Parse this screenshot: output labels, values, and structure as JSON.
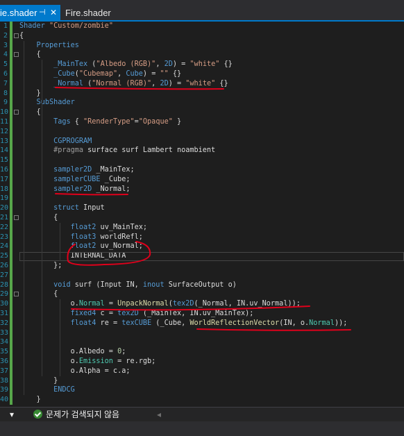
{
  "tabs": [
    {
      "label": "ie.shader",
      "active": true,
      "pin_glyph": "⊣",
      "close_glyph": "✕"
    },
    {
      "label": "Fire.shader",
      "active": false
    }
  ],
  "code_lines": [
    {
      "n": "1",
      "html": "<span class=\"kw\">Shader</span> <span class=\"str\">\"Custom/zombie\"</span>"
    },
    {
      "n": "2",
      "html": "{"
    },
    {
      "n": "3",
      "html": "    <span class=\"kw\">Properties</span>"
    },
    {
      "n": "4",
      "html": "    {"
    },
    {
      "n": "5",
      "html": "        <span class=\"kw\">_MainTex</span> (<span class=\"str\">\"Albedo (RGB)\"</span>, <span class=\"kw\">2D</span>) = <span class=\"str\">\"white\"</span> {}"
    },
    {
      "n": "6",
      "html": "        <span class=\"kw\">_Cube</span>(<span class=\"str\">\"Cubemap\"</span>, <span class=\"kw\">Cube</span>) = <span class=\"str\">\"\"</span> {}"
    },
    {
      "n": "7",
      "html": "        <span class=\"kw\">_Normal</span> (<span class=\"str\">\"Normal (RGB)\"</span>, <span class=\"kw\">2D</span>) = <span class=\"str\">\"white\"</span> {}"
    },
    {
      "n": "8",
      "html": "    }"
    },
    {
      "n": "9",
      "html": "    <span class=\"kw\">SubShader</span>"
    },
    {
      "n": "10",
      "html": "    {"
    },
    {
      "n": "11",
      "html": "        <span class=\"kw\">Tags</span> { <span class=\"str\">\"RenderType\"</span>=<span class=\"str\">\"Opaque\"</span> }"
    },
    {
      "n": "12",
      "html": ""
    },
    {
      "n": "13",
      "html": "        <span class=\"kw\">CGPROGRAM</span>"
    },
    {
      "n": "14",
      "html": "        <span class=\"pp\">#pragma</span> surface surf Lambert noambient"
    },
    {
      "n": "15",
      "html": ""
    },
    {
      "n": "16",
      "html": "        <span class=\"kw\">sampler2D</span> _MainTex;"
    },
    {
      "n": "17",
      "html": "        <span class=\"kw\">samplerCUBE</span> _Cube;"
    },
    {
      "n": "18",
      "html": "        <span class=\"kw\">sampler2D</span> _Normal;"
    },
    {
      "n": "19",
      "html": ""
    },
    {
      "n": "20",
      "html": "        <span class=\"kw\">struct</span> Input"
    },
    {
      "n": "21",
      "html": "        {"
    },
    {
      "n": "22",
      "html": "            <span class=\"kw\">float2</span> uv_MainTex;"
    },
    {
      "n": "23",
      "html": "            <span class=\"kw\">float3</span> worldRefl;"
    },
    {
      "n": "24",
      "html": "            <span class=\"kw\">float2</span> uv_Normal;"
    },
    {
      "n": "25",
      "html": "            INTERNAL_DATA"
    },
    {
      "n": "26",
      "html": "        };"
    },
    {
      "n": "27",
      "html": ""
    },
    {
      "n": "28",
      "html": "        <span class=\"kw\">void</span> surf (Input IN, <span class=\"kw\">inout</span> SurfaceOutput o)"
    },
    {
      "n": "29",
      "html": "        {"
    },
    {
      "n": "30",
      "html": "            o.<span class=\"fld\">Normal</span> = <span class=\"fn\">UnpackNormal</span>(<span class=\"kw\">tex2D</span>(_Normal, IN.uv_Normal));"
    },
    {
      "n": "31",
      "html": "            <span class=\"kw\">fixed4</span> c = <span class=\"kw\">tex2D</span> (_MainTex, IN.uv_MainTex);"
    },
    {
      "n": "32",
      "html": "            <span class=\"kw\">float4</span> re = <span class=\"kw\">texCUBE</span> (_Cube, <span class=\"fn\">WorldReflectionVector</span>(IN, o.<span class=\"fld\">Normal</span>));"
    },
    {
      "n": "33",
      "html": ""
    },
    {
      "n": "34",
      "html": ""
    },
    {
      "n": "35",
      "html": "            o.Albedo = <span class=\"num\">0</span>;"
    },
    {
      "n": "36",
      "html": "            o.<span class=\"fld\">Emission</span> = re.rgb;"
    },
    {
      "n": "37",
      "html": "            o.Alpha = c.a;"
    },
    {
      "n": "38",
      "html": "        }"
    },
    {
      "n": "39",
      "html": "        <span class=\"kw\">ENDCG</span>"
    },
    {
      "n": "40",
      "html": "    }"
    }
  ],
  "status": {
    "scroll_arrow": "▾",
    "message": "문제가 검색되지 않음",
    "left_arrow": "◂"
  },
  "colors": {
    "accent": "#007acc",
    "annotation_ink": "#e0001b"
  }
}
